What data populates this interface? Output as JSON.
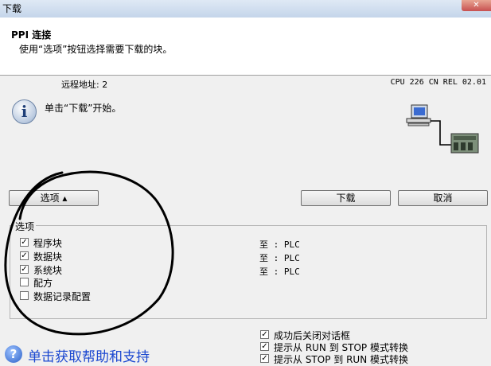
{
  "window": {
    "title": "下载",
    "close_glyph": "✕"
  },
  "header": {
    "title": "PPI 连接",
    "subtitle": "使用“选项”按钮选择需要下载的块。"
  },
  "connection": {
    "remote_address": "远程地址: 2",
    "cpu_info": "CPU 226 CN REL 02.01"
  },
  "info": {
    "icon_glyph": "i",
    "message": "单击“下载”开始。"
  },
  "buttons": {
    "options": "选项 ▴",
    "download": "下载",
    "cancel": "取消"
  },
  "options_group": {
    "title": "选项",
    "items": [
      {
        "label": "程序块",
        "checked": true,
        "dest": "至 : PLC"
      },
      {
        "label": "数据块",
        "checked": true,
        "dest": "至 : PLC"
      },
      {
        "label": "系统块",
        "checked": true,
        "dest": "至 : PLC"
      },
      {
        "label": "配方",
        "checked": false,
        "dest": ""
      },
      {
        "label": "数据记录配置",
        "checked": false,
        "dest": ""
      }
    ]
  },
  "post_options": [
    {
      "label": "成功后关闭对话框",
      "checked": true
    },
    {
      "label": "提示从 RUN 到 STOP 模式转换",
      "checked": true
    },
    {
      "label": "提示从 STOP 到 RUN 模式转换",
      "checked": true
    }
  ],
  "help": {
    "icon_glyph": "?",
    "link": "单击获取帮助和支持"
  }
}
